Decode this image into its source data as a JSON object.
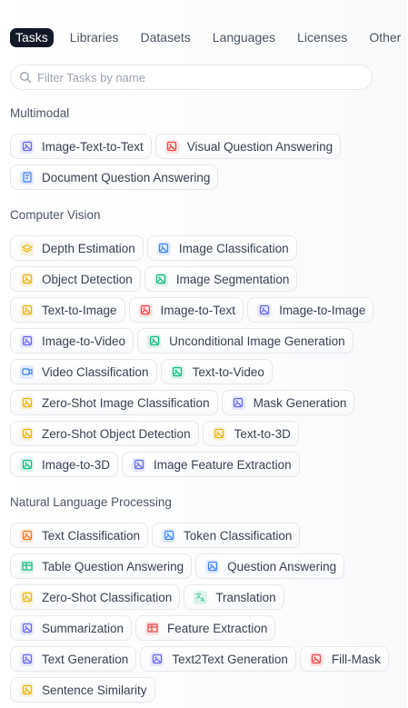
{
  "tabs": [
    {
      "label": "Tasks",
      "active": true
    },
    {
      "label": "Libraries"
    },
    {
      "label": "Datasets"
    },
    {
      "label": "Languages"
    },
    {
      "label": "Licenses"
    },
    {
      "label": "Other"
    }
  ],
  "search": {
    "placeholder": "Filter Tasks by name",
    "icon": "search-icon"
  },
  "colors": {
    "red": "#ef4444",
    "blue": "#3b82f6",
    "indigo": "#6366f1",
    "yellow": "#eab308",
    "green": "#10b981",
    "orange": "#f97316"
  },
  "sections": [
    {
      "title": "Multimodal",
      "items": [
        {
          "label": "Image-Text-to-Text",
          "icon": "image-text-icon",
          "color": "indigo"
        },
        {
          "label": "Visual Question Answering",
          "icon": "vqa-icon",
          "color": "red"
        },
        {
          "label": "Document Question Answering",
          "icon": "document-icon",
          "color": "blue"
        }
      ]
    },
    {
      "title": "Computer Vision",
      "items": [
        {
          "label": "Depth Estimation",
          "icon": "layers-icon",
          "color": "yellow"
        },
        {
          "label": "Image Classification",
          "icon": "image-classification-icon",
          "color": "blue"
        },
        {
          "label": "Object Detection",
          "icon": "object-detection-icon",
          "color": "yellow"
        },
        {
          "label": "Image Segmentation",
          "icon": "segmentation-icon",
          "color": "green"
        },
        {
          "label": "Text-to-Image",
          "icon": "text-to-image-icon",
          "color": "yellow"
        },
        {
          "label": "Image-to-Text",
          "icon": "image-to-text-icon",
          "color": "red"
        },
        {
          "label": "Image-to-Image",
          "icon": "image-to-image-icon",
          "color": "indigo"
        },
        {
          "label": "Image-to-Video",
          "icon": "image-to-video-icon",
          "color": "indigo"
        },
        {
          "label": "Unconditional Image Generation",
          "icon": "image-generation-icon",
          "color": "green"
        },
        {
          "label": "Video Classification",
          "icon": "video-icon",
          "color": "blue"
        },
        {
          "label": "Text-to-Video",
          "icon": "text-to-video-icon",
          "color": "green"
        },
        {
          "label": "Zero-Shot Image Classification",
          "icon": "zero-shot-image-icon",
          "color": "yellow"
        },
        {
          "label": "Mask Generation",
          "icon": "mask-icon",
          "color": "indigo"
        },
        {
          "label": "Zero-Shot Object Detection",
          "icon": "zero-shot-detection-icon",
          "color": "yellow"
        },
        {
          "label": "Text-to-3D",
          "icon": "text-to-3d-icon",
          "color": "yellow"
        },
        {
          "label": "Image-to-3D",
          "icon": "image-to-3d-icon",
          "color": "green"
        },
        {
          "label": "Image Feature Extraction",
          "icon": "feature-extraction-icon",
          "color": "indigo"
        }
      ]
    },
    {
      "title": "Natural Language Processing",
      "items": [
        {
          "label": "Text Classification",
          "icon": "text-classification-icon",
          "color": "orange"
        },
        {
          "label": "Token Classification",
          "icon": "token-icon",
          "color": "blue"
        },
        {
          "label": "Table Question Answering",
          "icon": "table-icon",
          "color": "green"
        },
        {
          "label": "Question Answering",
          "icon": "question-icon",
          "color": "blue"
        },
        {
          "label": "Zero-Shot Classification",
          "icon": "zero-shot-icon",
          "color": "yellow"
        },
        {
          "label": "Translation",
          "icon": "translation-icon",
          "color": "green"
        },
        {
          "label": "Summarization",
          "icon": "summarization-icon",
          "color": "indigo"
        },
        {
          "label": "Feature Extraction",
          "icon": "table-icon",
          "color": "red"
        },
        {
          "label": "Text Generation",
          "icon": "text-generation-icon",
          "color": "indigo"
        },
        {
          "label": "Text2Text Generation",
          "icon": "text2text-icon",
          "color": "indigo"
        },
        {
          "label": "Fill-Mask",
          "icon": "fill-mask-icon",
          "color": "red"
        },
        {
          "label": "Sentence Similarity",
          "icon": "similarity-icon",
          "color": "yellow"
        }
      ]
    }
  ]
}
